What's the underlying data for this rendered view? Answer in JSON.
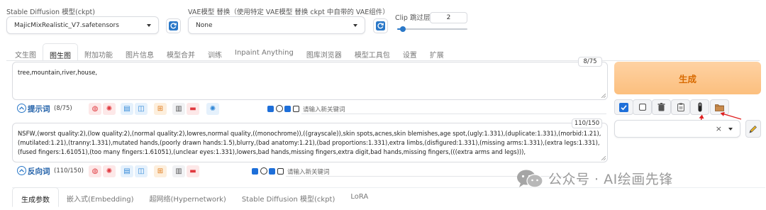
{
  "models": {
    "sd_model": {
      "label": "Stable Diffusion 模型(ckpt)",
      "value": "MajicMixRealistic_V7.safetensors"
    },
    "vae": {
      "label": "VAE模型 替换（使用特定 VAE模型 替换 ckpt 中自带的 VAE组件）",
      "value": "None"
    },
    "clip": {
      "label": "Clip 跳过层",
      "value": "2",
      "slider_fraction": 0.08
    }
  },
  "tabs": [
    {
      "label": "文生图",
      "active": false
    },
    {
      "label": "图生图",
      "active": true
    },
    {
      "label": "附加功能",
      "active": false
    },
    {
      "label": "图片信息",
      "active": false
    },
    {
      "label": "模型合并",
      "active": false
    },
    {
      "label": "训练",
      "active": false
    },
    {
      "label": "Inpaint Anything",
      "active": false
    },
    {
      "label": "图库浏览器",
      "active": false
    },
    {
      "label": "模型工具包",
      "active": false
    },
    {
      "label": "设置",
      "active": false
    },
    {
      "label": "扩展",
      "active": false
    }
  ],
  "prompt": {
    "text": "tree,mountain,river,house,",
    "counter": "8/75",
    "toolbar_label": "提示词",
    "toolbar_count": "(8/75)",
    "keyword_placeholder": "请输入新关键词"
  },
  "negative": {
    "text": "NSFW,(worst quality:2),(low quality:2),(normal quality:2),lowres,normal quality,((monochrome)),((grayscale)),skin spots,acnes,skin blemishes,age spot,(ugly:1.331),(duplicate:1.331),(morbid:1.21),(mutilated:1.21),(tranny:1.331),mutated hands,(poorly drawn hands:1.5),blurry,(bad anatomy:1.21),(bad proportions:1.331),extra limbs,(disfigured:1.331),(missing arms:1.331),(extra legs:1.331),(fused fingers:1.61051),(too many fingers:1.61051),(unclear eyes:1.331),lowers,bad hands,missing fingers,extra digit,bad hands,missing fingers,(((extra arms and legs))),",
    "counter": "110/150",
    "toolbar_label": "反向词",
    "toolbar_count": "(110/150)",
    "keyword_placeholder": "请输入新关键词"
  },
  "generate": {
    "label": "生成"
  },
  "style_select": {
    "clear": "×"
  },
  "bottom_tabs": [
    {
      "label": "生成参数",
      "active": true
    },
    {
      "label": "嵌入式(Embedding)",
      "active": false
    },
    {
      "label": "超网络(Hypernetwork)",
      "active": false
    },
    {
      "label": "Stable Diffusion 模型(ckpt)",
      "active": false
    },
    {
      "label": "LoRA",
      "active": false
    }
  ],
  "watermark": {
    "text": "公众号 · AI绘画先锋"
  },
  "colors": {
    "accent": "#ff7c00",
    "generate_bg": "#fdc88f",
    "generate_text": "#d86a00",
    "checkbox_blue": "#1e6fd9",
    "arrow_red": "#e02020"
  }
}
